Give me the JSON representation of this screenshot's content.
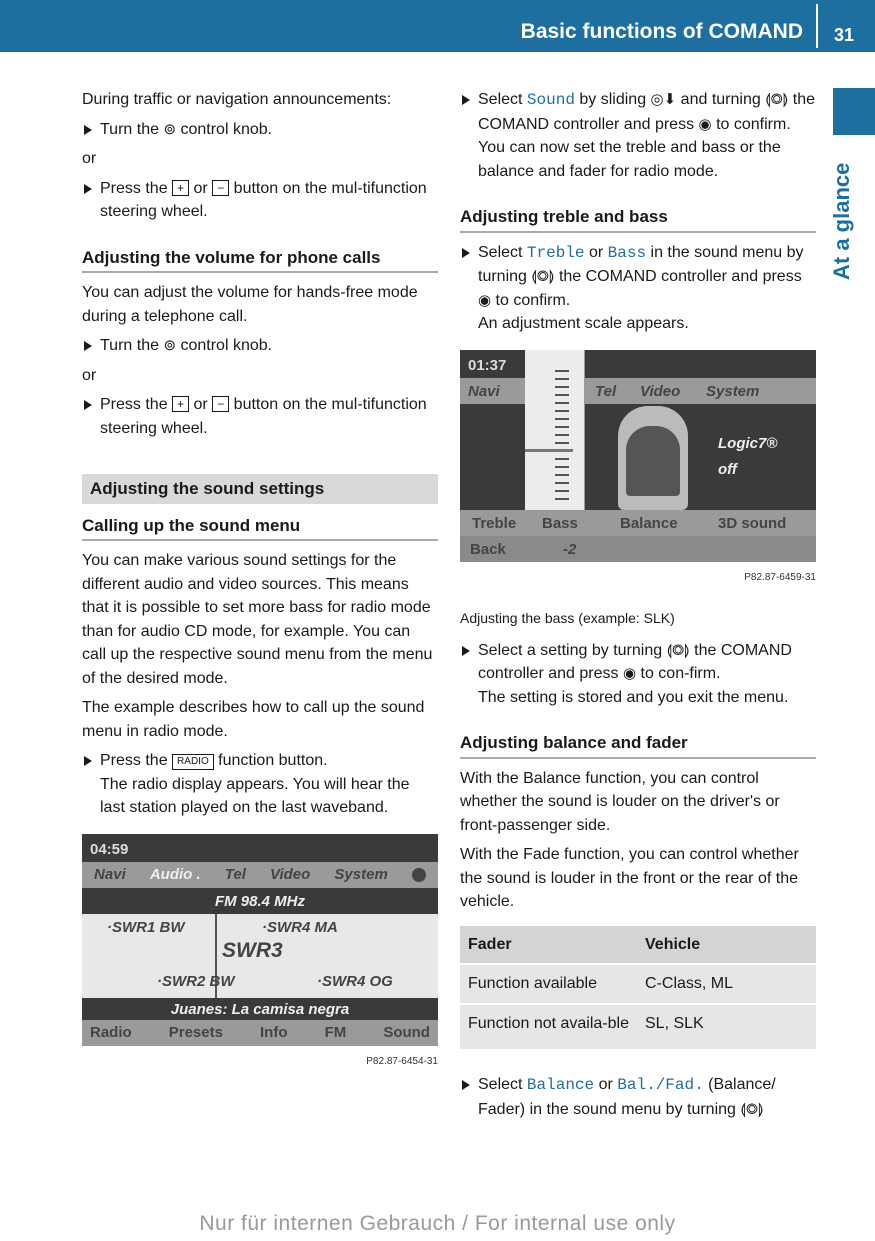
{
  "header": {
    "title": "Basic functions of COMAND",
    "page": "31",
    "side_tab": "At a glance"
  },
  "left": {
    "p1": "During traffic or navigation announcements:",
    "b1": [
      "Turn the",
      "control knob."
    ],
    "or": "or",
    "b2": [
      "Press the",
      "or",
      "button on the mul-tifunction steering wheel."
    ],
    "h1": "Adjusting the volume for phone calls",
    "p2": "You can adjust the volume for hands-free mode during a telephone call.",
    "b3": [
      "Turn the",
      "control knob."
    ],
    "b4": [
      "Press the",
      "or",
      "button on the mul-tifunction steering wheel."
    ],
    "section": "Adjusting the sound settings",
    "h2": "Calling up the sound menu",
    "p3": "You can make various sound settings for the different audio and video sources. This means that it is possible to set more bass for radio mode than for audio CD mode, for example. You can call up the respective sound menu from the menu of the desired mode.",
    "p4": "The example describes how to call up the sound menu in radio mode.",
    "b5": [
      "Press the",
      "RADIO",
      "function button."
    ],
    "b5_result": "The radio display appears. You will hear the last station played on the last waveband.",
    "screen": {
      "time": "04:59",
      "menu": [
        "Navi",
        "Audio .",
        "Tel",
        "Video",
        "System"
      ],
      "band": "FM 98.4 MHz",
      "stations": [
        "·SWR1 BW",
        "·SWR4 MA",
        "SWR3",
        "·SWR2 BW",
        "·SWR4 OG"
      ],
      "track": "Juanes: La camisa negra",
      "bottom": [
        "Radio",
        "Presets",
        "Info",
        "FM",
        "Sound"
      ],
      "code": "P82.87-6454-31"
    }
  },
  "right": {
    "b1": [
      "Select",
      "Sound",
      "by sliding",
      "and turning",
      "the COMAND controller and press",
      "to confirm."
    ],
    "b1_result": "You can now set the treble and bass or the balance and fader for radio mode.",
    "h1": "Adjusting treble and bass",
    "b2": [
      "Select",
      "Treble",
      "or",
      "Bass",
      "in the sound menu by turning",
      "the COMAND controller and press",
      "to confirm."
    ],
    "b2_result": "An adjustment scale appears.",
    "screen": {
      "time": "01:37",
      "menu": [
        "Navi",
        "Tel",
        "Video",
        "System"
      ],
      "logic": "Logic7®",
      "logic_state": "off",
      "bottom": [
        "Treble",
        "Bass",
        "Balance",
        "3D sound"
      ],
      "back": "Back",
      "value": "-2",
      "code": "P82.87-6459-31"
    },
    "caption": "Adjusting the bass (example: SLK)",
    "b3": [
      "Select a setting by turning",
      "the COMAND controller and press",
      "to con-firm."
    ],
    "b3_result": "The setting is stored and you exit the menu.",
    "h2": "Adjusting balance and fader",
    "p1": "With the Balance function, you can control whether the sound is louder on the driver's or front-passenger side.",
    "p2": "With the Fade function, you can control whether the sound is louder in the front or the rear of the vehicle.",
    "table": {
      "headers": [
        "Fader",
        "Vehicle"
      ],
      "rows": [
        [
          "Function available",
          "C-Class, ML"
        ],
        [
          "Function not availa-ble",
          "SL, SLK"
        ]
      ]
    },
    "b4": [
      "Select",
      "Balance",
      "or",
      "Bal./Fad.",
      "(Balance/ Fader) in the sound menu by turning"
    ]
  },
  "icons": {
    "knob": "⊚",
    "plus": "+",
    "minus": "−",
    "turn": "⟬◎⟭",
    "slide": "◎⬇",
    "press": "◉"
  },
  "footer": "Nur für internen Gebrauch / For internal use only",
  "colors": {
    "brand": "#1e6ea0"
  }
}
